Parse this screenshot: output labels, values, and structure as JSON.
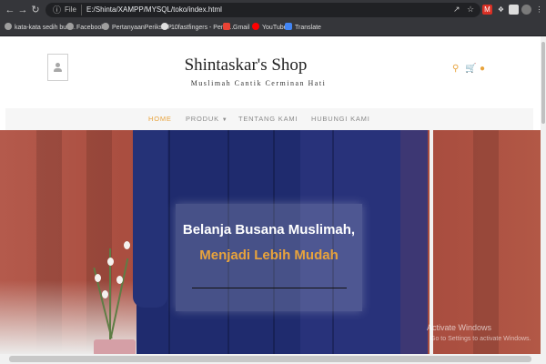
{
  "browser": {
    "address": {
      "scheme_label": "File",
      "url": "E:/Shinta/XAMPP/MYSQL/toko/index.html"
    },
    "bookmarks": [
      {
        "label": "kata-kata sedih bua...",
        "color": "#9e9e9e"
      },
      {
        "label": "Facebook",
        "color": "#9e9e9e"
      },
      {
        "label": "PertanyaanPeriksa P...",
        "color": "#9e9e9e"
      },
      {
        "label": "10fastfingers - Pene...",
        "color": "#e0e0e0"
      },
      {
        "label": "Gmail",
        "color": "#ea4335"
      },
      {
        "label": "YouTube",
        "color": "#ff0000"
      },
      {
        "label": "Translate",
        "color": "#4285f4"
      }
    ]
  },
  "site": {
    "title": "Shintaskar's Shop",
    "tagline": "Muslimah Cantik Cerminan Hati",
    "accent_color": "#e8a33c",
    "header_icons": [
      "search-icon",
      "cart-icon",
      "chat-icon"
    ],
    "nav": [
      {
        "label": "HOME",
        "active": true
      },
      {
        "label": "PRODUK",
        "dropdown": true,
        "active": false
      },
      {
        "label": "TENTANG KAMI",
        "active": false
      },
      {
        "label": "HUBUNGI KAMI",
        "active": false
      }
    ],
    "hero": {
      "line1": "Belanja Busana Muslimah,",
      "line2": "Menjadi Lebih Mudah"
    }
  },
  "os": {
    "watermark_title": "Activate Windows",
    "watermark_sub": "Go to Settings to activate Windows."
  }
}
